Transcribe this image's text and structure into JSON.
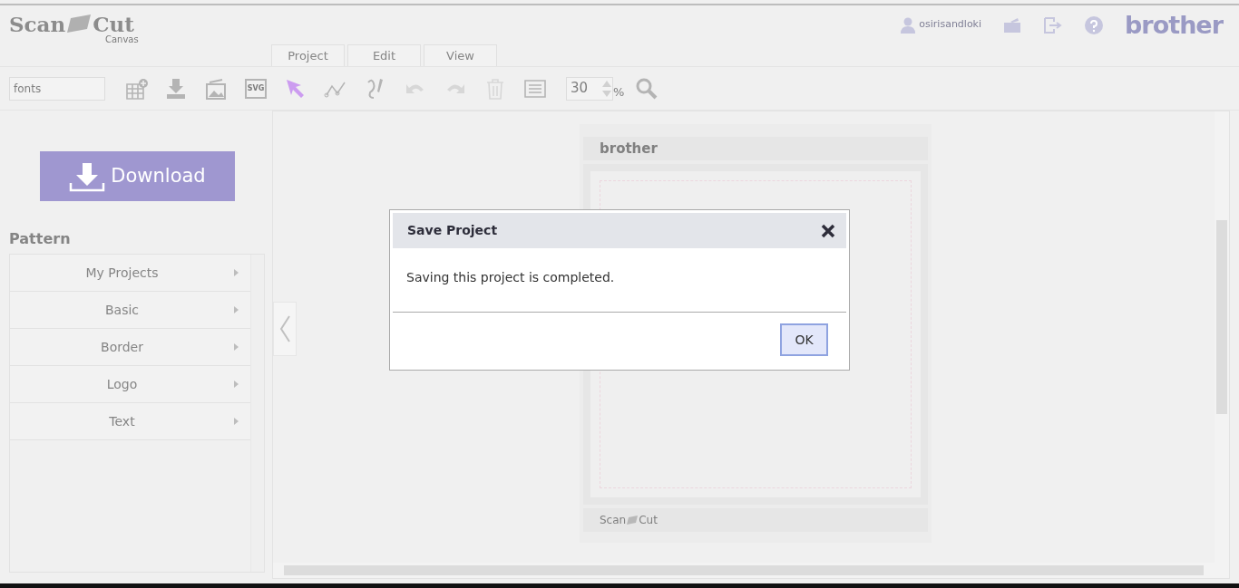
{
  "logo": {
    "left": "Scan",
    "right": "Cut",
    "sub": "Canvas"
  },
  "user": {
    "name": "osirisandloki"
  },
  "brand": "brother",
  "tabs": [
    {
      "label": "Project",
      "selected": false
    },
    {
      "label": "Edit",
      "selected": false
    },
    {
      "label": "View",
      "selected": false
    }
  ],
  "search": {
    "value": "fonts"
  },
  "tools": [
    {
      "selected": false,
      "disabled": false
    },
    {
      "selected": false,
      "disabled": false
    },
    {
      "selected": false,
      "disabled": false
    },
    {
      "selected": false,
      "disabled": false,
      "label": "SVG"
    },
    {
      "selected": true,
      "disabled": false
    },
    {
      "selected": false,
      "disabled": false
    },
    {
      "selected": false,
      "disabled": false
    },
    {
      "selected": false,
      "disabled": true
    },
    {
      "selected": false,
      "disabled": true
    },
    {
      "selected": false,
      "disabled": true
    },
    {
      "selected": false,
      "disabled": false
    }
  ],
  "zoom": {
    "value": "30",
    "unit": "%"
  },
  "download_button": "Download",
  "pattern": {
    "title": "Pattern",
    "items": [
      "My Projects",
      "Basic",
      "Border",
      "Logo",
      "Text"
    ]
  },
  "mat": {
    "header": "brother",
    "footer_left": "Scan",
    "footer_right": "Cut"
  },
  "dialog": {
    "title": "Save Project",
    "message": "Saving this project is completed.",
    "button": "OK"
  }
}
